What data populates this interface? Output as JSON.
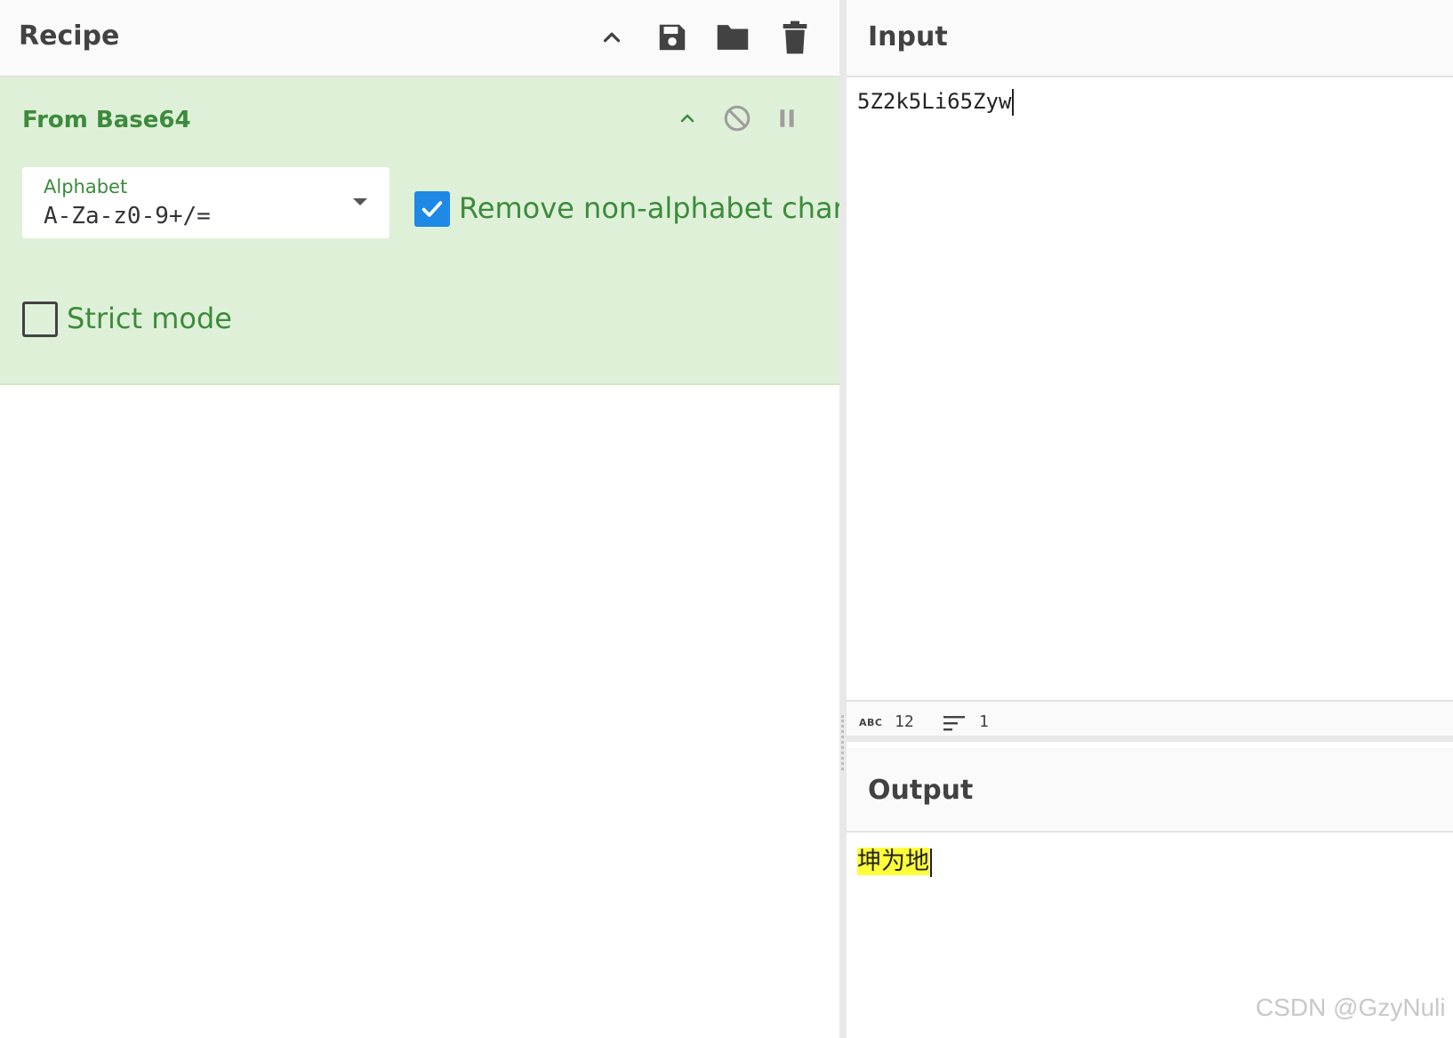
{
  "recipe": {
    "title": "Recipe",
    "actions": {
      "collapse": "chevron-up-icon",
      "save": "save-icon",
      "load": "folder-icon",
      "clear": "trash-icon"
    },
    "operation": {
      "name": "From Base64",
      "alphabet_label": "Alphabet",
      "alphabet_value": "A-Za-z0-9+/=",
      "remove_non_alphabet": {
        "label": "Remove non-alphabet chars",
        "checked": true
      },
      "strict_mode": {
        "label": "Strict mode",
        "checked": false
      }
    }
  },
  "input": {
    "title": "Input",
    "text": "5Z2k5Li65Zyw"
  },
  "status": {
    "char_count": "12",
    "line_count": "1",
    "abc_label": "ABC"
  },
  "output": {
    "title": "Output",
    "text": "坤为地"
  },
  "watermark": "CSDN @GzyNuli",
  "colors": {
    "accent_green": "#3c8b3c",
    "card_bg": "#dff0d8",
    "checkbox_blue": "#1e88e5",
    "highlight_yellow": "#ffff3a"
  }
}
